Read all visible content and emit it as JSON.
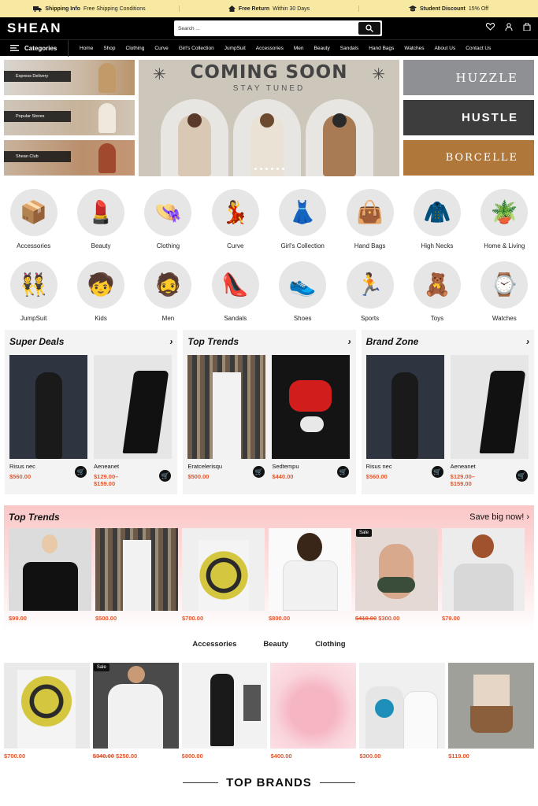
{
  "topbar": [
    {
      "icon": "truck-icon",
      "bold": "Shipping Info",
      "text": "Free Shipping Conditions"
    },
    {
      "icon": "home-icon",
      "bold": "Free Return",
      "text": "Within 30 Days"
    },
    {
      "icon": "graduation-cap-icon",
      "bold": "Student Discount",
      "text": "15% Off"
    }
  ],
  "header": {
    "logo": "SHEAN",
    "search_placeholder": "Search ..."
  },
  "nav": {
    "categories_label": "Categories",
    "links": [
      "Home",
      "Shop",
      "Clothing",
      "Curve",
      "Girl's Collection",
      "JumpSuit",
      "Accessories",
      "Men",
      "Beauty",
      "Sandals",
      "Hand Bags",
      "Watches",
      "About Us",
      "Contact Us"
    ]
  },
  "hero": {
    "left": [
      "Express Delivery",
      "Popular Stores",
      "Shean Club"
    ],
    "title": "COMING SOON",
    "subtitle": "STAY TUNED",
    "right": [
      "HUZZLE",
      "HUSTLE",
      "BORCELLE"
    ]
  },
  "categories_row1": [
    "Accessories",
    "Beauty",
    "Clothing",
    "Curve",
    "Girl's Collection",
    "Hand Bags",
    "High Necks",
    "Home & Living"
  ],
  "categories_row2": [
    "JumpSuit",
    "Kids",
    "Men",
    "Sandals",
    "Shoes",
    "Sports",
    "Toys",
    "Watches"
  ],
  "deals": [
    {
      "title": "Super Deals",
      "products": [
        {
          "name": "Risus nec",
          "price": "$560.00"
        },
        {
          "name": "Aeneanet",
          "price": "$129.00–\n$159.00"
        }
      ]
    },
    {
      "title": "Top Trends",
      "products": [
        {
          "name": "Eratcelerisqu",
          "price": "$500.00"
        },
        {
          "name": "Sedtempu",
          "price": "$440.00"
        }
      ]
    },
    {
      "title": "Brand Zone",
      "products": [
        {
          "name": "Risus nec",
          "price": "$560.00"
        },
        {
          "name": "Aeneanet",
          "price": "$129.00–\n$159.00"
        }
      ]
    }
  ],
  "trend_banner": {
    "title": "Top Trends",
    "cta": "Save big now!",
    "sale_label": "Sale",
    "items": [
      {
        "price": "$99.00"
      },
      {
        "price": "$500.00"
      },
      {
        "price": "$700.00"
      },
      {
        "price": "$800.00"
      },
      {
        "old": "$410.00",
        "price": "$300.00"
      },
      {
        "price": "$79.00"
      }
    ]
  },
  "tabs": [
    "Accessories",
    "Beauty",
    "Clothing"
  ],
  "grid": {
    "sale_label": "Sale",
    "items": [
      {
        "price": "$700.00"
      },
      {
        "old": "$340.00",
        "price": "$250.00"
      },
      {
        "price": "$800.00"
      },
      {
        "price": "$400.00"
      },
      {
        "price": "$300.00"
      },
      {
        "price": "$119.00"
      }
    ]
  },
  "brands_title": "TOP BRANDS",
  "colors": {
    "topbar": "#f7e8a2",
    "accent_price": "#e4572e",
    "header": "#000000",
    "trend_bg": "#fbc7c7"
  }
}
